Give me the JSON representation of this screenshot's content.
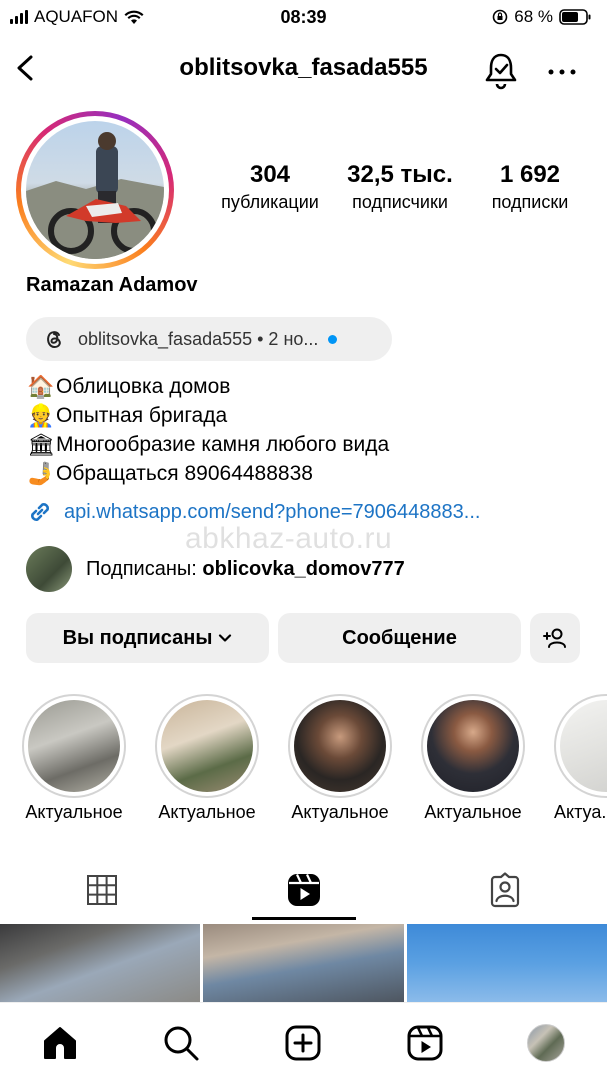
{
  "status_bar": {
    "carrier": "AQUAFON",
    "time": "08:39",
    "battery": "68 %"
  },
  "header": {
    "username": "oblitsovka_fasada555"
  },
  "profile": {
    "display_name": "Ramazan Adamov",
    "stats": [
      {
        "value": "304",
        "label": "публикации"
      },
      {
        "value": "32,5 тыс.",
        "label": "подписчики"
      },
      {
        "value": "1 692",
        "label": "подписки"
      }
    ],
    "threads": {
      "text": "oblitsovka_fasada555 • 2 но..."
    },
    "bio": [
      {
        "emoji": "🏠",
        "text": "Облицовка домов"
      },
      {
        "emoji": "👷",
        "text": "Опытная бригада"
      },
      {
        "emoji": "🏛",
        "text": "Многообразие камня любого вида"
      },
      {
        "emoji": "🤳",
        "text": "Обращаться 89064488838"
      }
    ],
    "link": "api.whatsapp.com/send?phone=7906448883...",
    "watermark": "abkhaz-auto.ru",
    "followed_by": {
      "prefix": "Подписаны: ",
      "name": "oblicovka_domov777"
    }
  },
  "actions": {
    "following_label": "Вы подписаны",
    "message_label": "Сообщение"
  },
  "highlights": [
    {
      "label": "Актуальное"
    },
    {
      "label": "Актуальное"
    },
    {
      "label": "Актуальное"
    },
    {
      "label": "Актуальное"
    },
    {
      "label": "Актуа..."
    }
  ],
  "tabs": [
    "grid-icon",
    "reels-icon",
    "tagged-icon"
  ],
  "bottom_nav": [
    "home-icon",
    "search-icon",
    "create-icon",
    "reels-icon",
    "profile-avatar"
  ],
  "colors": {
    "link": "#1d74c5",
    "threads_dot": "#0095f6",
    "button_bg": "#efefef"
  }
}
